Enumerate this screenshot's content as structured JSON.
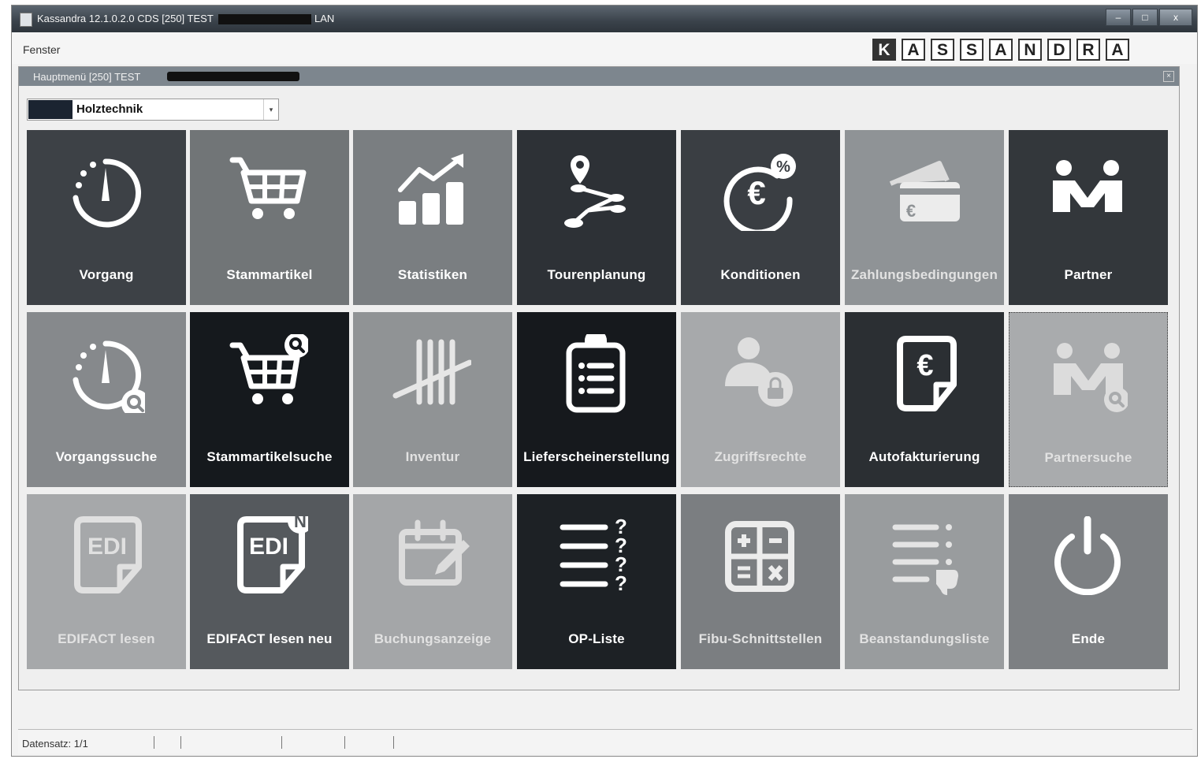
{
  "window": {
    "title": "Kassandra 12.1.0.2.0 CDS [250] TEST",
    "title_suffix": "LAN",
    "buttons": {
      "minimize": "–",
      "maximize": "□",
      "close": "x"
    }
  },
  "menubar": {
    "fenster": "Fenster",
    "logo": [
      "K",
      "A",
      "S",
      "S",
      "A",
      "N",
      "D",
      "R",
      "A"
    ]
  },
  "internal_frame": {
    "title": "Hauptmenü [250] TEST",
    "close": "×"
  },
  "combo": {
    "value": "Holztechnik",
    "arrow": "▾",
    "swatch_color": "#1b2431"
  },
  "tiles": [
    {
      "label": "Vorgang",
      "color": "#3d4146",
      "icon": "gauge-icon"
    },
    {
      "label": "Stammartikel",
      "color": "#717577",
      "icon": "shopping-cart-icon"
    },
    {
      "label": "Statistiken",
      "color": "#7a7e81",
      "icon": "bar-chart-trend-icon"
    },
    {
      "label": "Tourenplanung",
      "color": "#2d3136",
      "icon": "route-icon"
    },
    {
      "label": "Konditionen",
      "color": "#3a3e43",
      "icon": "euro-percent-icon"
    },
    {
      "label": "Zahlungsbedingungen",
      "color": "#8f9396",
      "icon": "credit-cards-icon"
    },
    {
      "label": "Partner",
      "color": "#33373b",
      "icon": "handshake-icon"
    },
    {
      "label": "Vorgangssuche",
      "color": "#86898c",
      "icon": "gauge-search-icon"
    },
    {
      "label": "Stammartikelsuche",
      "color": "#15191d",
      "icon": "cart-search-icon"
    },
    {
      "label": "Inventur",
      "color": "#909395",
      "icon": "tally-icon"
    },
    {
      "label": "Lieferscheinerstellung",
      "color": "#16191d",
      "icon": "clipboard-list-icon"
    },
    {
      "label": "Zugriffsrechte",
      "color": "#a7a9ab",
      "icon": "user-lock-icon"
    },
    {
      "label": "Autofakturierung",
      "color": "#2b2f33",
      "icon": "euro-document-icon"
    },
    {
      "label": "Partnersuche",
      "color": "#a9abad",
      "icon": "handshake-search-icon"
    },
    {
      "label": "EDIFACT lesen",
      "color": "#a6a8aa",
      "icon": "edi-document-icon"
    },
    {
      "label": "EDIFACT lesen neu",
      "color": "#55595d",
      "icon": "edi-new-icon"
    },
    {
      "label": "Buchungsanzeige",
      "color": "#a4a6a8",
      "icon": "calendar-edit-icon"
    },
    {
      "label": "OP-Liste",
      "color": "#1d2125",
      "icon": "question-list-icon"
    },
    {
      "label": "Fibu-Schnittstellen",
      "color": "#7b7e81",
      "icon": "calculator-icon"
    },
    {
      "label": "Beanstandungsliste",
      "color": "#999c9e",
      "icon": "list-thumbs-down-icon"
    },
    {
      "label": "Ende",
      "color": "#7d8083",
      "icon": "power-icon"
    }
  ],
  "statusbar": {
    "text": "Datensatz: 1/1"
  }
}
